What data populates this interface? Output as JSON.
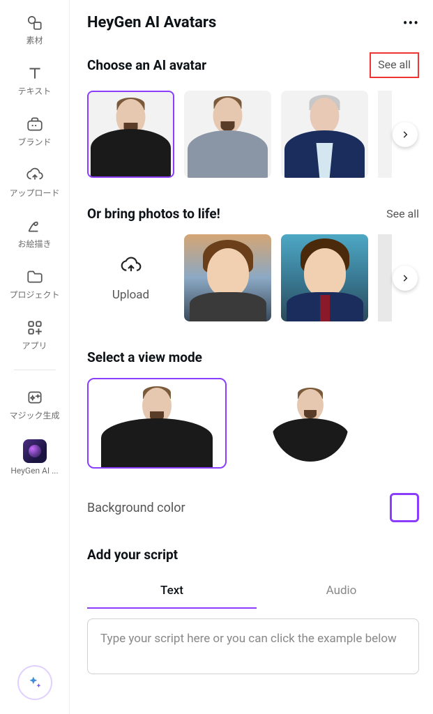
{
  "sidebar": {
    "items": [
      {
        "label": "素材"
      },
      {
        "label": "テキスト"
      },
      {
        "label": "ブランド"
      },
      {
        "label": "アップロード"
      },
      {
        "label": "お絵描き"
      },
      {
        "label": "プロジェクト"
      },
      {
        "label": "アプリ"
      },
      {
        "label": "マジック生成"
      }
    ],
    "app_shortcut": "HeyGen AI ..."
  },
  "header": {
    "title": "HeyGen AI Avatars"
  },
  "choose": {
    "title": "Choose an AI avatar",
    "see_all": "See all"
  },
  "photos": {
    "title": "Or bring photos to life!",
    "see_all": "See all",
    "upload_label": "Upload"
  },
  "viewmode": {
    "title": "Select a view mode"
  },
  "bg": {
    "label": "Background color",
    "value": "#ffffff"
  },
  "script": {
    "title": "Add your script",
    "tabs": {
      "text": "Text",
      "audio": "Audio"
    },
    "placeholder": "Type your script here or you can click the example below"
  }
}
